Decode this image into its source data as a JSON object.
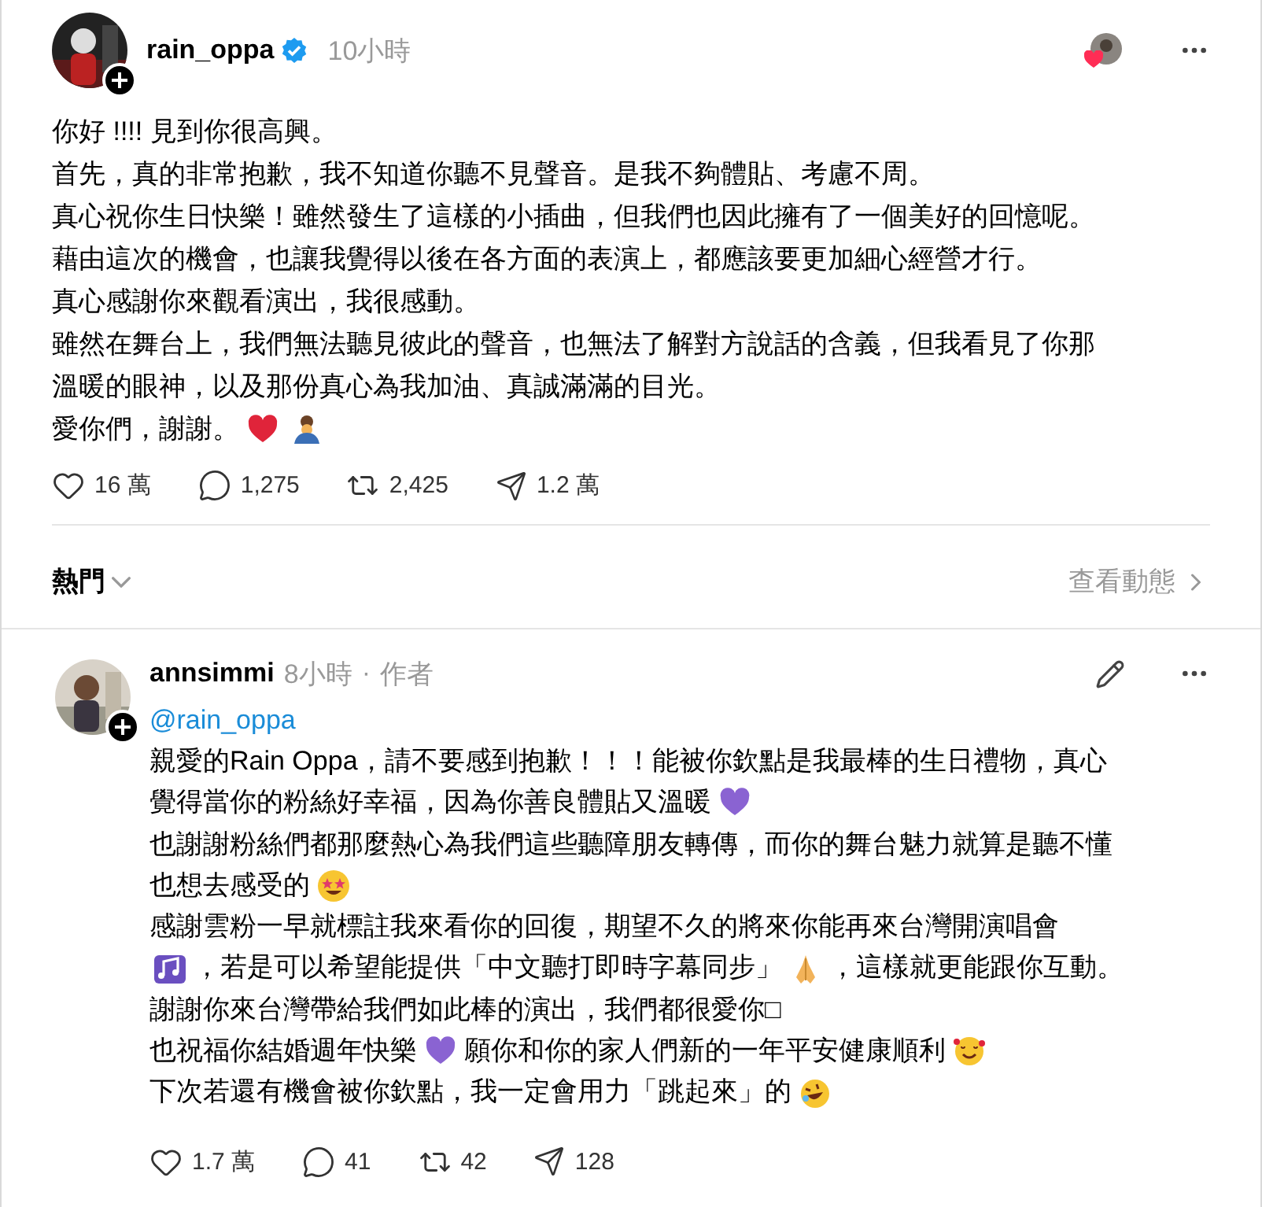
{
  "post": {
    "author": "rain_oppa",
    "verified": true,
    "time": "10小時",
    "liked_by_author": true,
    "lines": [
      [
        {
          "kind": "text",
          "text": "你好 !!!! 見到你很高興。"
        }
      ],
      [
        {
          "kind": "text",
          "text": "首先，真的非常抱歉，我不知道你聽不見聲音。是我不夠體貼、考慮不周。"
        }
      ],
      [
        {
          "kind": "text",
          "text": "真心祝你生日快樂！雖然發生了這樣的小插曲，但我們也因此擁有了一個美好的回憶呢。"
        }
      ],
      [
        {
          "kind": "text",
          "text": "藉由這次的機會，也讓我覺得以後在各方面的表演上，都應該要更加細心經營才行。"
        }
      ],
      [
        {
          "kind": "text",
          "text": "真心感謝你來觀看演出，我很感動。"
        }
      ],
      [
        {
          "kind": "text",
          "text": "雖然在舞台上，我們無法聽見彼此的聲音，也無法了解對方說話的含義，但我看見了你那"
        }
      ],
      [
        {
          "kind": "text",
          "text": "溫暖的眼神，以及那份真心為我加油、真誠滿滿的目光。"
        }
      ],
      [
        {
          "kind": "text",
          "text": "愛你們，謝謝。"
        },
        {
          "kind": "heart",
          "color": "#e0243a"
        },
        {
          "kind": "bowing"
        }
      ]
    ],
    "stats": {
      "likes": "16 萬",
      "replies": "1,275",
      "reposts": "2,425",
      "shares": "1.2 萬"
    }
  },
  "sort": {
    "label": "熱門",
    "activity_link": "查看動態"
  },
  "reply": {
    "author": "annsimmi",
    "time": "8小時",
    "separator": "·",
    "role": "作者",
    "mention": "@rain_oppa",
    "lines": [
      [
        {
          "kind": "text",
          "text": "親愛的Rain Oppa，請不要感到抱歉！！！能被你欽點是我最棒的生日禮物，真心"
        }
      ],
      [
        {
          "kind": "text",
          "text": "覺得當你的粉絲好幸福，因為你善良體貼又溫暖"
        },
        {
          "kind": "heart",
          "color": "#8a63d2"
        }
      ],
      [
        {
          "kind": "text",
          "text": "也謝謝粉絲們都那麼熱心為我們這些聽障朋友轉傳，而你的舞台魅力就算是聽不懂"
        }
      ],
      [
        {
          "kind": "text",
          "text": "也想去感受的"
        },
        {
          "kind": "starstruck"
        }
      ],
      [
        {
          "kind": "text",
          "text": "感謝雲粉一早就標註我來看你的回復，期望不久的將來你能再來台灣開演唱會"
        }
      ],
      [
        {
          "kind": "notes"
        },
        {
          "kind": "text",
          "text": "，若是可以希望能提供「中文聽打即時字幕同步」"
        },
        {
          "kind": "pray"
        },
        {
          "kind": "text",
          "text": "，這樣就更能跟你互動。"
        }
      ],
      [
        {
          "kind": "text",
          "text": "謝謝你來台灣帶給我們如此棒的演出，我們都很愛你□"
        }
      ],
      [
        {
          "kind": "text",
          "text": "也祝福你結婚週年快樂"
        },
        {
          "kind": "heart",
          "color": "#8a63d2"
        },
        {
          "kind": "text",
          "text": "願你和你的家人們新的一年平安健康順利"
        },
        {
          "kind": "hearteyes"
        }
      ],
      [
        {
          "kind": "text",
          "text": "下次若還有機會被你欽點，我一定會用力「跳起來」的"
        },
        {
          "kind": "laughing"
        }
      ]
    ],
    "stats": {
      "likes": "1.7 萬",
      "replies": "41",
      "reposts": "42",
      "shares": "128"
    }
  }
}
